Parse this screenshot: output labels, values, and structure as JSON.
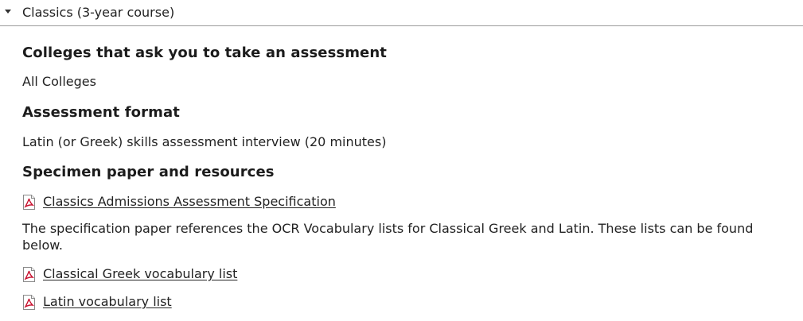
{
  "accordion": {
    "title": "Classics (3-year course)",
    "expanded": true
  },
  "sections": {
    "colleges": {
      "heading": "Colleges that ask you to take an assessment",
      "value": "All Colleges"
    },
    "format": {
      "heading": "Assessment format",
      "value": "Latin (or Greek) skills assessment interview (20 minutes)"
    },
    "resources": {
      "heading": "Specimen paper and resources",
      "link_spec": "Classics Admissions Assessment Specification",
      "note_line1": "The specification paper references the OCR Vocabulary lists for Classical Greek and Latin. These lists can be found",
      "note_line2": "below.",
      "link_greek": "Classical Greek vocabulary list",
      "link_latin": "Latin vocabulary list"
    }
  },
  "icons": {
    "caret": "caret-down-icon",
    "pdf": "pdf-file-icon",
    "pdf_accent": "#c8102e"
  }
}
